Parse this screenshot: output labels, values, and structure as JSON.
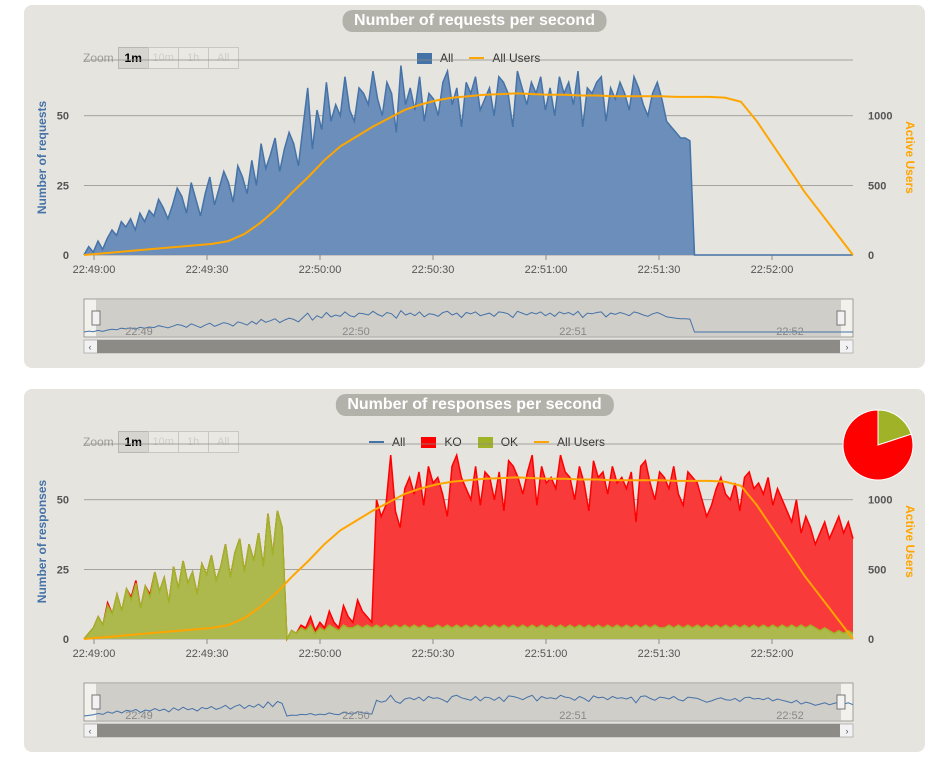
{
  "colors": {
    "all": "#4572a7",
    "all_fill": "#6b8fba",
    "ko": "#ff0000",
    "ko_fill": "#f83a3a",
    "ok": "#a0b228",
    "ok_fill": "#adb94d",
    "users": "#ffa500",
    "grid": "#8d8c87"
  },
  "zoom": {
    "label": "Zoom",
    "buttons": [
      "1m",
      "10m",
      "1h",
      "All"
    ],
    "selected": "1m"
  },
  "chart_data": [
    {
      "type": "area",
      "title": "Number of requests per second",
      "ylabel": "Number of requests",
      "y2label": "Active Users",
      "ylim": [
        0,
        70
      ],
      "y2lim": [
        0,
        1400
      ],
      "yticks": [
        "0",
        "25",
        "50"
      ],
      "y2ticks": [
        "0",
        "500",
        "1000"
      ],
      "xticks": [
        "22:49:00",
        "22:49:30",
        "22:50:00",
        "22:50:30",
        "22:51:00",
        "22:51:30",
        "22:52:00"
      ],
      "navigator_ticks": [
        "22:49",
        "22:50",
        "22:51",
        "22:52"
      ],
      "legend": [
        "All",
        "All Users"
      ],
      "series": [
        {
          "name": "All",
          "type": "area",
          "values": [
            0,
            3,
            1,
            5,
            2,
            6,
            9,
            7,
            12,
            10,
            13,
            9,
            15,
            12,
            16,
            14,
            20,
            17,
            13,
            18,
            24,
            21,
            15,
            26,
            20,
            14,
            22,
            28,
            18,
            24,
            30,
            26,
            19,
            32,
            28,
            22,
            34,
            25,
            40,
            31,
            36,
            42,
            30,
            38,
            44,
            40,
            32,
            46,
            60,
            38,
            52,
            45,
            62,
            48,
            54,
            50,
            64,
            52,
            48,
            60,
            58,
            54,
            66,
            56,
            50,
            62,
            58,
            44,
            68,
            54,
            60,
            52,
            64,
            48,
            58,
            56,
            50,
            62,
            66,
            54,
            60,
            46,
            62,
            58,
            64,
            52,
            56,
            60,
            50,
            64,
            62,
            58,
            46,
            66,
            60,
            54,
            62,
            58,
            64,
            52,
            60,
            50,
            64,
            58,
            62,
            54,
            66,
            46,
            60,
            58,
            62,
            64,
            48,
            60,
            56,
            62,
            58,
            52,
            64,
            60,
            54,
            50,
            58,
            62,
            56,
            48,
            46,
            44,
            42,
            42,
            41,
            0,
            0,
            0,
            0,
            0,
            0,
            0,
            0,
            0,
            0,
            0,
            0,
            0,
            0,
            0,
            0,
            0,
            0,
            0,
            0,
            0,
            0,
            0,
            0,
            0,
            0,
            0,
            0,
            0,
            0,
            0,
            0,
            0,
            0,
            0
          ]
        },
        {
          "name": "All Users",
          "type": "line",
          "axis": "right",
          "values": [
            0,
            10,
            20,
            30,
            40,
            50,
            60,
            70,
            80,
            100,
            150,
            230,
            330,
            450,
            560,
            680,
            780,
            850,
            920,
            980,
            1040,
            1080,
            1110,
            1130,
            1140,
            1150,
            1155,
            1160,
            1155,
            1150,
            1150,
            1145,
            1145,
            1140,
            1140,
            1140,
            1140,
            1135,
            1135,
            1135,
            1130,
            1100,
            960,
            790,
            620,
            450,
            300,
            150,
            0
          ]
        }
      ]
    },
    {
      "type": "area",
      "title": "Number of responses per second",
      "ylabel": "Number of responses",
      "y2label": "Active Users",
      "ylim": [
        0,
        70
      ],
      "y2lim": [
        0,
        1400
      ],
      "yticks": [
        "0",
        "25",
        "50"
      ],
      "y2ticks": [
        "0",
        "500",
        "1000"
      ],
      "xticks": [
        "22:49:00",
        "22:49:30",
        "22:50:00",
        "22:50:30",
        "22:51:00",
        "22:51:30",
        "22:52:00"
      ],
      "navigator_ticks": [
        "22:49",
        "22:50",
        "22:51",
        "22:52"
      ],
      "legend": [
        "All",
        "KO",
        "OK",
        "All Users"
      ],
      "series": [
        {
          "name": "OK",
          "type": "area",
          "values": [
            0,
            2,
            4,
            8,
            5,
            12,
            9,
            16,
            10,
            18,
            14,
            20,
            11,
            19,
            15,
            24,
            17,
            22,
            13,
            26,
            18,
            28,
            20,
            24,
            16,
            27,
            23,
            30,
            21,
            26,
            34,
            22,
            31,
            36,
            24,
            34,
            28,
            38,
            26,
            45,
            30,
            46,
            40,
            0,
            3,
            2,
            4,
            3,
            5,
            2,
            4,
            3,
            5,
            4,
            3,
            5,
            4,
            4,
            5,
            4,
            5,
            4,
            5,
            4,
            5,
            4,
            5,
            4,
            5,
            4,
            5,
            4,
            5,
            4,
            4,
            5,
            4,
            5,
            4,
            5,
            4,
            5,
            4,
            5,
            4,
            5,
            4,
            5,
            4,
            5,
            4,
            5,
            4,
            5,
            4,
            5,
            4,
            5,
            4,
            5,
            4,
            5,
            4,
            5,
            4,
            5,
            4,
            5,
            4,
            5,
            4,
            5,
            4,
            5,
            4,
            5,
            4,
            5,
            4,
            5,
            4,
            5,
            4,
            4,
            5,
            4,
            5,
            4,
            5,
            4,
            5,
            4,
            5,
            4,
            5,
            4,
            5,
            4,
            5,
            4,
            5,
            4,
            5,
            4,
            5,
            4,
            5,
            4,
            5,
            4,
            5,
            4,
            5,
            4,
            5,
            4,
            3,
            4,
            3,
            2,
            3,
            2,
            3,
            2
          ]
        },
        {
          "name": "KO",
          "type": "area",
          "values": [
            0,
            2,
            4,
            8,
            5,
            13,
            9,
            16,
            10,
            18,
            15,
            21,
            11,
            19,
            16,
            24,
            17,
            22,
            13,
            26,
            18,
            28,
            20,
            24,
            16,
            27,
            23,
            30,
            21,
            26,
            34,
            22,
            31,
            36,
            24,
            34,
            28,
            38,
            26,
            45,
            30,
            46,
            40,
            0,
            3,
            2,
            5,
            4,
            8,
            3,
            6,
            4,
            10,
            6,
            4,
            12,
            8,
            6,
            14,
            10,
            8,
            6,
            50,
            44,
            48,
            66,
            46,
            40,
            54,
            58,
            52,
            60,
            48,
            62,
            56,
            58,
            52,
            44,
            62,
            66,
            58,
            54,
            50,
            62,
            48,
            60,
            58,
            50,
            60,
            46,
            64,
            62,
            58,
            52,
            60,
            66,
            48,
            62,
            56,
            58,
            54,
            66,
            60,
            58,
            50,
            62,
            56,
            46,
            64,
            58,
            60,
            52,
            62,
            56,
            58,
            54,
            60,
            42,
            62,
            64,
            56,
            50,
            60,
            58,
            54,
            62,
            52,
            48,
            60,
            58,
            56,
            50,
            44,
            48,
            54,
            58,
            52,
            50,
            56,
            46,
            58,
            60,
            54,
            56,
            52,
            58,
            48,
            54,
            50,
            46,
            42,
            50,
            38,
            44,
            40,
            34,
            38,
            42,
            36,
            40,
            44,
            38,
            42,
            36
          ]
        },
        {
          "name": "All Users",
          "type": "line",
          "axis": "right",
          "values": [
            0,
            10,
            20,
            30,
            40,
            50,
            60,
            70,
            80,
            100,
            150,
            230,
            330,
            450,
            560,
            680,
            780,
            850,
            920,
            980,
            1040,
            1080,
            1110,
            1130,
            1140,
            1150,
            1155,
            1160,
            1155,
            1150,
            1150,
            1145,
            1145,
            1140,
            1140,
            1140,
            1140,
            1135,
            1135,
            1135,
            1130,
            1100,
            960,
            790,
            620,
            450,
            300,
            150,
            0
          ]
        }
      ],
      "pie": [
        {
          "name": "KO",
          "value": 80
        },
        {
          "name": "OK",
          "value": 20
        }
      ]
    }
  ]
}
